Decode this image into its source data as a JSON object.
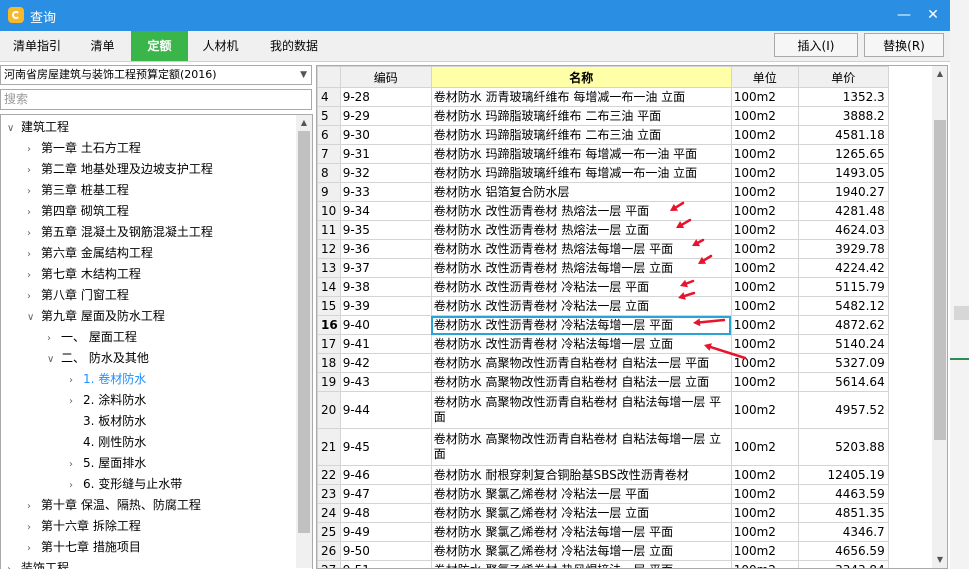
{
  "window": {
    "title": "查询",
    "minimize": "—",
    "maximize": "□",
    "close": "✕"
  },
  "tabs": [
    {
      "label": "清单指引"
    },
    {
      "label": "清单"
    },
    {
      "label": "定额",
      "active": true
    },
    {
      "label": "人材机"
    },
    {
      "label": "我的数据"
    }
  ],
  "actions": {
    "insert_label": "插入(I)",
    "replace_label": "替换(R)"
  },
  "left": {
    "quota_library": "河南省房屋建筑与装饰工程预算定额(2016)",
    "search_placeholder": "搜索",
    "tree": [
      {
        "label": "建筑工程",
        "level": 0,
        "toggle": "v"
      },
      {
        "label": "第一章  土石方工程",
        "level": 1,
        "toggle": ">"
      },
      {
        "label": "第二章  地基处理及边坡支护工程",
        "level": 1,
        "toggle": ">"
      },
      {
        "label": "第三章  桩基工程",
        "level": 1,
        "toggle": ">"
      },
      {
        "label": "第四章  砌筑工程",
        "level": 1,
        "toggle": ">"
      },
      {
        "label": "第五章  混凝土及钢筋混凝土工程",
        "level": 1,
        "toggle": ">"
      },
      {
        "label": "第六章  金属结构工程",
        "level": 1,
        "toggle": ">"
      },
      {
        "label": "第七章  木结构工程",
        "level": 1,
        "toggle": ">"
      },
      {
        "label": "第八章  门窗工程",
        "level": 1,
        "toggle": ">"
      },
      {
        "label": "第九章  屋面及防水工程",
        "level": 1,
        "toggle": "v"
      },
      {
        "label": "一、  屋面工程",
        "level": 2,
        "toggle": ">"
      },
      {
        "label": "二、  防水及其他",
        "level": 2,
        "toggle": "v"
      },
      {
        "label": "1.  卷材防水",
        "level": 3,
        "toggle": ">",
        "selected": true
      },
      {
        "label": "2.  涂料防水",
        "level": 3,
        "toggle": ">"
      },
      {
        "label": "3.  板材防水",
        "level": 3,
        "toggle": ""
      },
      {
        "label": "4.  刚性防水",
        "level": 3,
        "toggle": ""
      },
      {
        "label": "5.  屋面排水",
        "level": 3,
        "toggle": ">"
      },
      {
        "label": "6.  变形缝与止水带",
        "level": 3,
        "toggle": ">"
      },
      {
        "label": "第十章  保温、隔热、防腐工程",
        "level": 1,
        "toggle": ">"
      },
      {
        "label": "第十六章  拆除工程",
        "level": 1,
        "toggle": ">"
      },
      {
        "label": "第十七章  措施项目",
        "level": 1,
        "toggle": ">"
      },
      {
        "label": "装饰工程",
        "level": 0,
        "toggle": ">"
      }
    ]
  },
  "grid": {
    "columns": {
      "index": "",
      "code": "编码",
      "name": "名称",
      "unit": "单位",
      "price": "单价"
    },
    "rows": [
      {
        "no": "4",
        "code": "9-28",
        "name": "卷材防水 沥青玻璃纤维布 每增减一布一油 立面",
        "unit": "100m2",
        "price": "1352.3"
      },
      {
        "no": "5",
        "code": "9-29",
        "name": "卷材防水 玛蹄脂玻璃纤维布 二布三油 平面",
        "unit": "100m2",
        "price": "3888.2"
      },
      {
        "no": "6",
        "code": "9-30",
        "name": "卷材防水 玛蹄脂玻璃纤维布 二布三油 立面",
        "unit": "100m2",
        "price": "4581.18"
      },
      {
        "no": "7",
        "code": "9-31",
        "name": "卷材防水 玛蹄脂玻璃纤维布 每增减一布一油 平面",
        "unit": "100m2",
        "price": "1265.65"
      },
      {
        "no": "8",
        "code": "9-32",
        "name": "卷材防水 玛蹄脂玻璃纤维布 每增减一布一油 立面",
        "unit": "100m2",
        "price": "1493.05"
      },
      {
        "no": "9",
        "code": "9-33",
        "name": "卷材防水 铝箔复合防水层",
        "unit": "100m2",
        "price": "1940.27"
      },
      {
        "no": "10",
        "code": "9-34",
        "name": "卷材防水 改性沥青卷材 热熔法一层 平面",
        "unit": "100m2",
        "price": "4281.48"
      },
      {
        "no": "11",
        "code": "9-35",
        "name": "卷材防水 改性沥青卷材 热熔法一层 立面",
        "unit": "100m2",
        "price": "4624.03"
      },
      {
        "no": "12",
        "code": "9-36",
        "name": "卷材防水 改性沥青卷材 热熔法每增一层 平面",
        "unit": "100m2",
        "price": "3929.78"
      },
      {
        "no": "13",
        "code": "9-37",
        "name": "卷材防水 改性沥青卷材 热熔法每增一层 立面",
        "unit": "100m2",
        "price": "4224.42"
      },
      {
        "no": "14",
        "code": "9-38",
        "name": "卷材防水 改性沥青卷材 冷粘法一层 平面",
        "unit": "100m2",
        "price": "5115.79"
      },
      {
        "no": "15",
        "code": "9-39",
        "name": "卷材防水 改性沥青卷材 冷粘法一层 立面",
        "unit": "100m2",
        "price": "5482.12"
      },
      {
        "no": "16",
        "code": "9-40",
        "name": "卷材防水 改性沥青卷材 冷粘法每增一层 平面",
        "unit": "100m2",
        "price": "4872.62",
        "current": true
      },
      {
        "no": "17",
        "code": "9-41",
        "name": "卷材防水 改性沥青卷材 冷粘法每增一层 立面",
        "unit": "100m2",
        "price": "5140.24"
      },
      {
        "no": "18",
        "code": "9-42",
        "name": "卷材防水 高聚物改性沥青自粘卷材 自粘法一层 平面",
        "unit": "100m2",
        "price": "5327.09"
      },
      {
        "no": "19",
        "code": "9-43",
        "name": "卷材防水 高聚物改性沥青自粘卷材 自粘法一层 立面",
        "unit": "100m2",
        "price": "5614.64"
      },
      {
        "no": "20",
        "code": "9-44",
        "name": "卷材防水 高聚物改性沥青自粘卷材 自粘法每增一层 平面",
        "unit": "100m2",
        "price": "4957.52",
        "tall": true
      },
      {
        "no": "21",
        "code": "9-45",
        "name": "卷材防水 高聚物改性沥青自粘卷材 自粘法每增一层 立面",
        "unit": "100m2",
        "price": "5203.88",
        "tall": true
      },
      {
        "no": "22",
        "code": "9-46",
        "name": "卷材防水 耐根穿刺复合铜胎基SBS改性沥青卷材",
        "unit": "100m2",
        "price": "12405.19"
      },
      {
        "no": "23",
        "code": "9-47",
        "name": "卷材防水 聚氯乙烯卷材 冷粘法一层 平面",
        "unit": "100m2",
        "price": "4463.59"
      },
      {
        "no": "24",
        "code": "9-48",
        "name": "卷材防水 聚氯乙烯卷材 冷粘法一层 立面",
        "unit": "100m2",
        "price": "4851.35"
      },
      {
        "no": "25",
        "code": "9-49",
        "name": "卷材防水 聚氯乙烯卷材 冷粘法每增一层 平面",
        "unit": "100m2",
        "price": "4346.7"
      },
      {
        "no": "26",
        "code": "9-50",
        "name": "卷材防水 聚氯乙烯卷材 冷粘法每增一层 立面",
        "unit": "100m2",
        "price": "4656.59"
      },
      {
        "no": "27",
        "code": "9-51",
        "name": "卷材防水 聚氯乙烯卷材 热风焊接法一层 平面",
        "unit": "100m2",
        "price": "3343.84"
      }
    ]
  },
  "annotation_color": "#e8132d",
  "colors": {
    "titlebar": "#2a8fe3",
    "active_tab": "#39b54a",
    "name_header": "#ffffa8",
    "selected_tree": "#1e90ff"
  }
}
